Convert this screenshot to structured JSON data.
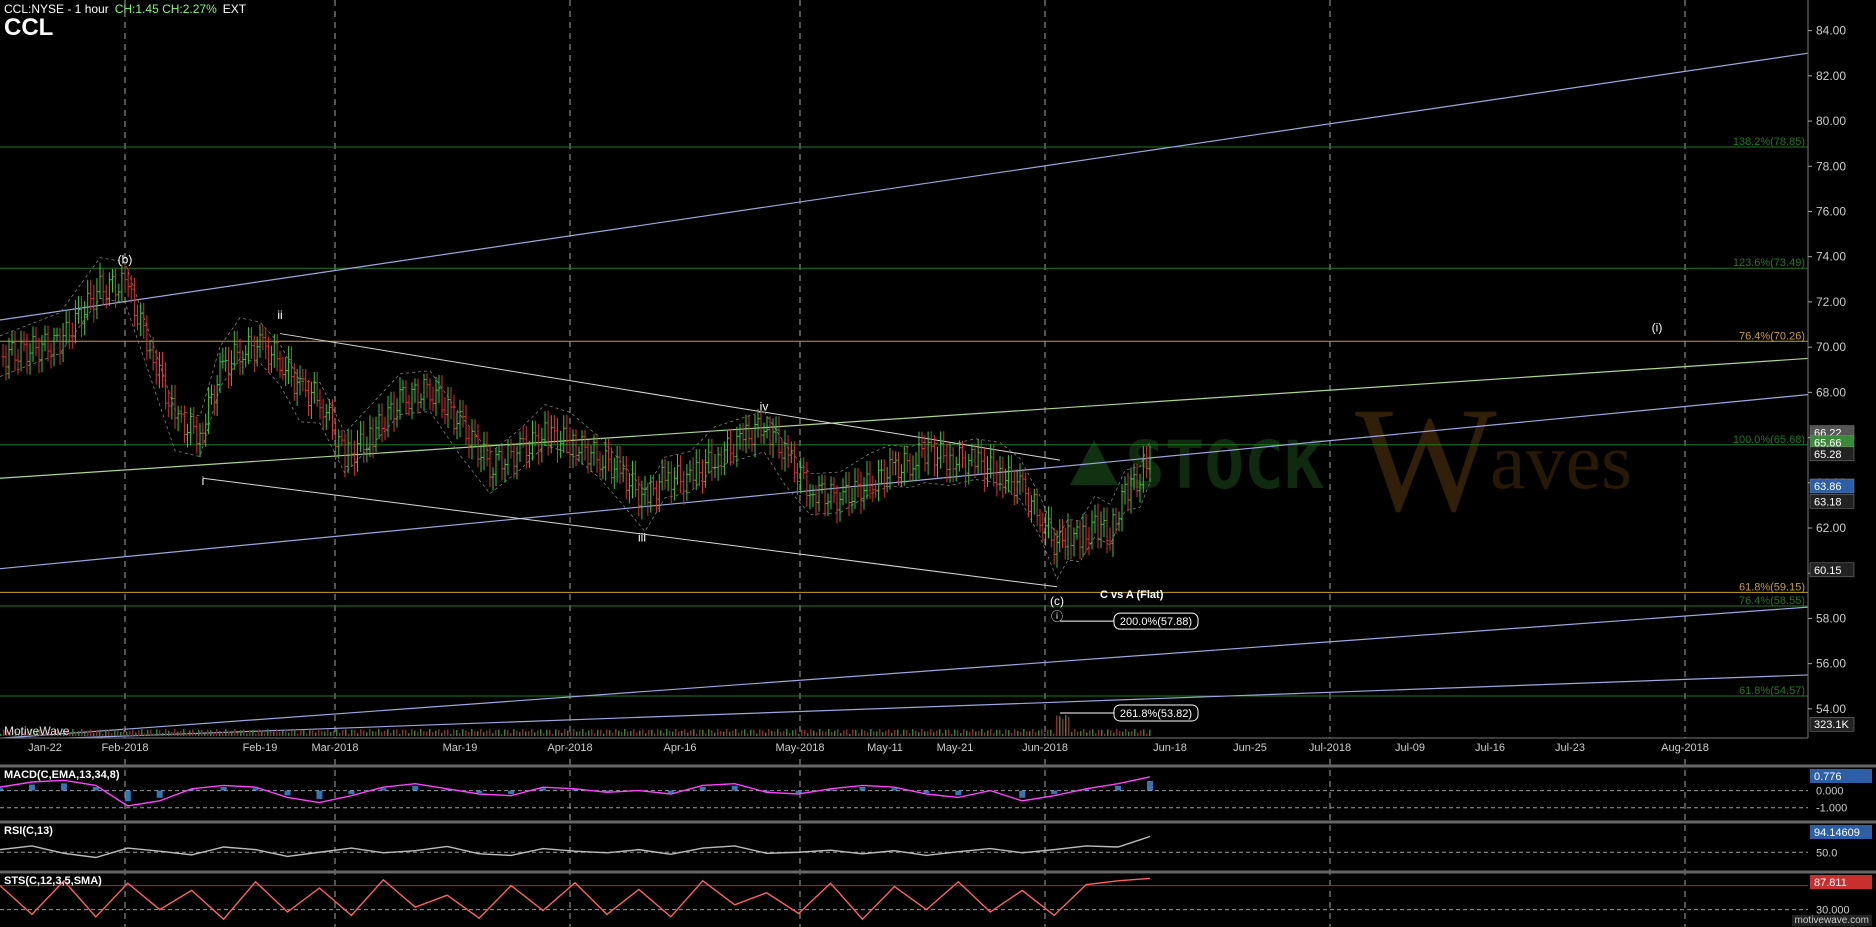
{
  "header": {
    "symbol": "CCL:NYSE - 1 hour",
    "change": "CH:1.45  CH:2.27%",
    "session": "EXT",
    "ticker": "CCL"
  },
  "watermark": {
    "brand_left": "STOCK",
    "brand_right": "aves",
    "brand_w": "W",
    "platform": "MotiveWave",
    "url": "motivewave.com"
  },
  "colors": {
    "background": "#000000",
    "bull_bar": "#2ecc40",
    "bear_bar": "#e03030",
    "fib_green": "#1e7a1e",
    "fib_gold": "#c8a020",
    "channel_blue": "#9ea6e0",
    "channel_green": "#a8d88a",
    "triangle": "#d8d8d8",
    "macd_line": "#ff40ff",
    "macd_hist": "#4aa8ff",
    "rsi_line": "#bbbbbb",
    "sts_line": "#ff6060"
  },
  "chart_data": {
    "type": "line",
    "title": "CCL",
    "price_axis": {
      "ylim": [
        52.8,
        85.0
      ],
      "ticks": [
        "84.00",
        "82.00",
        "80.00",
        "78.00",
        "76.00",
        "74.00",
        "72.00",
        "70.00",
        "68.00",
        "66.00",
        "64.00",
        "62.00",
        "60.00",
        "58.00",
        "56.00",
        "54.00"
      ],
      "tick_values": [
        84,
        82,
        80,
        78,
        76,
        74,
        72,
        70,
        68,
        66,
        64,
        62,
        60,
        58,
        56,
        54
      ]
    },
    "x_axis": {
      "labels": [
        "Jan-22",
        "Feb-2018",
        "Feb-19",
        "Mar-2018",
        "Mar-19",
        "Apr-2018",
        "Apr-16",
        "May-2018",
        "May-11",
        "May-21",
        "Jun-2018",
        "Jun-18",
        "Jun-25",
        "Jul-2018",
        "Jul-09",
        "Jul-16",
        "Jul-23",
        "Aug-2018"
      ],
      "label_t": [
        45,
        125,
        260,
        335,
        460,
        570,
        680,
        800,
        885,
        955,
        1045,
        1170,
        1250,
        1330,
        1410,
        1490,
        1570,
        1685
      ],
      "gridlines_t": [
        125,
        335,
        570,
        800,
        1045,
        1330,
        1685
      ]
    },
    "price_badges": [
      {
        "label": "66.22",
        "value": 66.22,
        "style": "gray"
      },
      {
        "label": "65.66",
        "value": 65.78,
        "style": "green"
      },
      {
        "label": "65.28",
        "value": 65.28,
        "style": "dark"
      },
      {
        "label": "63.86",
        "value": 63.86,
        "style": "blue"
      },
      {
        "label": "63.18",
        "value": 63.18,
        "style": "dark"
      },
      {
        "label": "60.15",
        "value": 60.15,
        "style": "dark"
      },
      {
        "label": "323.1K",
        "value": 53.32,
        "style": "dark"
      }
    ],
    "fib_levels": [
      {
        "label": "138.2%(78.85)",
        "value": 78.85,
        "color": "green"
      },
      {
        "label": "123.6%(73.49)",
        "value": 73.49,
        "color": "green"
      },
      {
        "label": "76.4%(70.26)",
        "value": 70.26,
        "color": "gold"
      },
      {
        "label": "100.0%(65.68)",
        "value": 65.68,
        "color": "green"
      },
      {
        "label": "61.8%(59.15)",
        "value": 59.15,
        "color": "gold"
      },
      {
        "label": "76.4%(58.55)",
        "value": 58.55,
        "color": "green"
      },
      {
        "label": "61.8%(54.57)",
        "value": 54.57,
        "color": "green"
      }
    ],
    "callouts": [
      {
        "label": "200.0%(57.88)",
        "t": 1112,
        "value": 57.88
      },
      {
        "label": "261.8%(53.82)",
        "t": 1112,
        "value": 53.82
      }
    ],
    "flat_note": "C vs A (Flat)",
    "wave_labels": [
      {
        "text": "(b)",
        "t": 125,
        "value": 73.7
      },
      {
        "text": "ii",
        "t": 280,
        "value": 71.25
      },
      {
        "text": "i",
        "t": 203,
        "value": 63.9
      },
      {
        "text": "iii",
        "t": 642,
        "value": 61.4
      },
      {
        "text": "iv",
        "t": 764,
        "value": 67.2
      },
      {
        "text": "(c)",
        "t": 1057,
        "value": 58.6
      },
      {
        "text": "ⓘ",
        "t": 1057,
        "value": 57.9
      },
      {
        "text": "(i)",
        "t": 1657,
        "value": 70.7
      }
    ],
    "price_series": {
      "name": "",
      "t": [
        0,
        60,
        100,
        125,
        150,
        175,
        200,
        220,
        240,
        260,
        280,
        300,
        320,
        345,
        370,
        400,
        430,
        460,
        490,
        520,
        545,
        570,
        600,
        620,
        645,
        665,
        690,
        715,
        740,
        764,
        785,
        810,
        840,
        870,
        890,
        910,
        925,
        950,
        975,
        1000,
        1020,
        1040,
        1057,
        1068,
        1080,
        1095,
        1110,
        1125,
        1140,
        1150
      ],
      "close": [
        69.6,
        70.2,
        72.6,
        72.8,
        70.0,
        66.8,
        66.2,
        68.8,
        69.9,
        70.0,
        69.5,
        68.1,
        67.8,
        65.1,
        66.0,
        67.6,
        68.2,
        66.6,
        64.8,
        65.4,
        66.1,
        65.8,
        65.1,
        64.5,
        63.2,
        64.3,
        64.1,
        65.1,
        65.8,
        66.6,
        65.3,
        63.7,
        63.3,
        63.9,
        64.5,
        64.9,
        65.4,
        65.1,
        64.9,
        64.4,
        63.8,
        62.6,
        61.1,
        61.9,
        61.4,
        62.1,
        61.7,
        63.6,
        64.2,
        65.4
      ]
    },
    "indicators": [
      {
        "name": "MACD(C,EMA,13,34,8)",
        "ticks": [
          "0.000",
          "-1.000"
        ],
        "badge": "0.776",
        "ylim": [
          -1.6,
          1.2
        ],
        "tick_values": [
          0,
          -1
        ],
        "values": [
          0.2,
          0.5,
          0.6,
          0.3,
          -0.9,
          -0.6,
          0.1,
          0.3,
          0.2,
          -0.4,
          -0.7,
          -0.3,
          0.2,
          0.4,
          0.1,
          -0.2,
          -0.3,
          0.2,
          0.1,
          -0.1,
          0.0,
          -0.2,
          0.3,
          0.4,
          -0.1,
          -0.2,
          0.1,
          0.3,
          0.2,
          -0.2,
          -0.4,
          0.0,
          -0.6,
          -0.3,
          0.1,
          0.4,
          0.8
        ]
      },
      {
        "name": "RSI(C,13)",
        "ticks": [
          "50.0"
        ],
        "badge": "94.14609",
        "ylim": [
          20,
          100
        ],
        "tick_values": [
          50
        ],
        "values": [
          55,
          62,
          48,
          40,
          58,
          52,
          45,
          60,
          55,
          42,
          50,
          58,
          49,
          53,
          61,
          47,
          44,
          57,
          52,
          49,
          55,
          46,
          58,
          62,
          48,
          50,
          54,
          47,
          53,
          44,
          51,
          57,
          49,
          55,
          62,
          60,
          80
        ]
      },
      {
        "name": "STS(C,12,3,5,SMA)",
        "ticks": [
          "30.000"
        ],
        "badge": "87.811",
        "ylim": [
          0,
          100
        ],
        "tick_values": [
          30,
          80
        ],
        "values": [
          80,
          20,
          90,
          15,
          85,
          30,
          70,
          10,
          88,
          25,
          75,
          18,
          92,
          35,
          60,
          12,
          80,
          28,
          86,
          20,
          72,
          15,
          90,
          40,
          65,
          22,
          85,
          10,
          78,
          30,
          88,
          25,
          70,
          18,
          82,
          90,
          95
        ]
      }
    ]
  }
}
